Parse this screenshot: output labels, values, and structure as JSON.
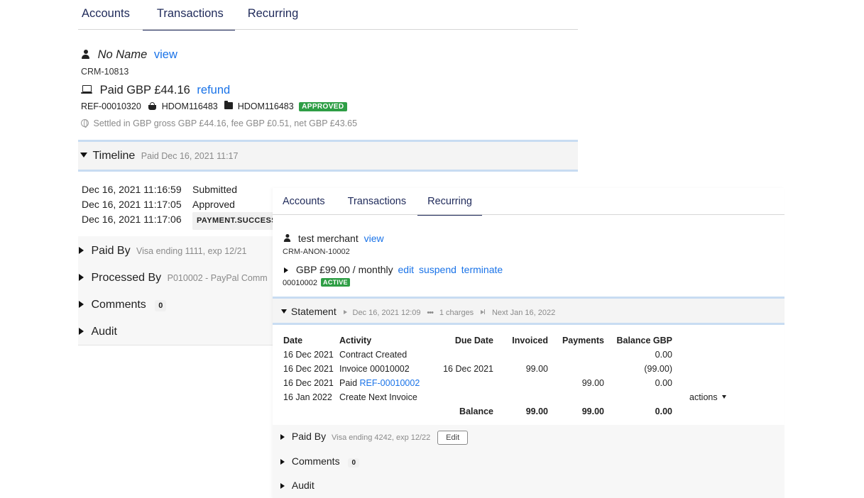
{
  "panel1": {
    "tabs": [
      {
        "label": "Accounts",
        "active": false
      },
      {
        "label": "Transactions",
        "active": true
      },
      {
        "label": "Recurring",
        "active": false
      }
    ],
    "customer": {
      "icon": "person-icon",
      "name": "No Name",
      "view_link": "view",
      "crm_id": "CRM-10813"
    },
    "payment": {
      "icon": "laptop-icon",
      "title": "Paid GBP £44.16",
      "refund_link": "refund",
      "reference": "REF-00010320",
      "basket_icon": "basket-icon",
      "basket_id": "HDOM116483",
      "folder_icon": "folder-icon",
      "folder_id": "HDOM116483",
      "status_badge": "APPROVED",
      "settlement_icon": "globe-icon",
      "settlement": "Settled in GBP gross GBP £44.16, fee GBP £0.51, net GBP £43.65"
    },
    "timeline": {
      "label": "Timeline",
      "summary": "Paid Dec 16, 2021 11:17",
      "events": [
        {
          "time": "Dec 16, 2021 11:16:59",
          "event": "Submitted"
        },
        {
          "time": "Dec 16, 2021 11:17:05",
          "event": "Approved"
        },
        {
          "time": "Dec 16, 2021 11:17:06",
          "event": "PAYMENT.SUCCESS"
        }
      ]
    },
    "sections": {
      "paid_by": {
        "label": "Paid By",
        "detail": "Visa ending 1111, exp 12/21"
      },
      "processed_by": {
        "label": "Processed By",
        "detail": "P010002 - PayPal Comm"
      },
      "comments": {
        "label": "Comments",
        "count": "0"
      },
      "audit": {
        "label": "Audit"
      }
    }
  },
  "panel2": {
    "tabs": [
      {
        "label": "Accounts",
        "active": false
      },
      {
        "label": "Transactions",
        "active": false
      },
      {
        "label": "Recurring",
        "active": true
      }
    ],
    "customer": {
      "icon": "person-icon",
      "name": "test merchant",
      "view_link": "view",
      "crm_id": "CRM-ANON-10002"
    },
    "plan": {
      "title": "GBP £99.00 / monthly",
      "edit_link": "edit",
      "suspend_link": "suspend",
      "terminate_link": "terminate",
      "id": "00010002",
      "status_badge": "ACTIVE"
    },
    "statement": {
      "label": "Statement",
      "date": "Dec 16, 2021 12:09",
      "charges": "1 charges",
      "next": "Next Jan 16, 2022",
      "columns": [
        "Date",
        "Activity",
        "Due Date",
        "Invoiced",
        "Payments",
        "Balance GBP"
      ],
      "rows": [
        {
          "date": "16 Dec 2021",
          "activity": "Contract Created",
          "activity_link": "",
          "due": "",
          "invoiced": "",
          "payments": "",
          "balance": "0.00"
        },
        {
          "date": "16 Dec 2021",
          "activity": "Invoice 00010002",
          "activity_link": "",
          "due": "16 Dec 2021",
          "invoiced": "99.00",
          "payments": "",
          "balance": "(99.00)"
        },
        {
          "date": "16 Dec 2021",
          "activity": "Paid ",
          "activity_link": "REF-00010002",
          "due": "",
          "invoiced": "",
          "payments": "99.00",
          "balance": "0.00"
        },
        {
          "date": "16 Jan 2022",
          "activity": "Create Next Invoice",
          "activity_link": "",
          "due": "",
          "invoiced": "",
          "payments": "",
          "balance": ""
        }
      ],
      "actions_label": "actions",
      "totals": {
        "label": "Balance",
        "invoiced": "99.00",
        "payments": "99.00",
        "balance": "0.00"
      }
    },
    "sections": {
      "paid_by": {
        "label": "Paid By",
        "detail": "Visa ending 4242, exp 12/22",
        "edit_button": "Edit"
      },
      "comments": {
        "label": "Comments",
        "count": "0"
      },
      "audit": {
        "label": "Audit"
      }
    }
  }
}
